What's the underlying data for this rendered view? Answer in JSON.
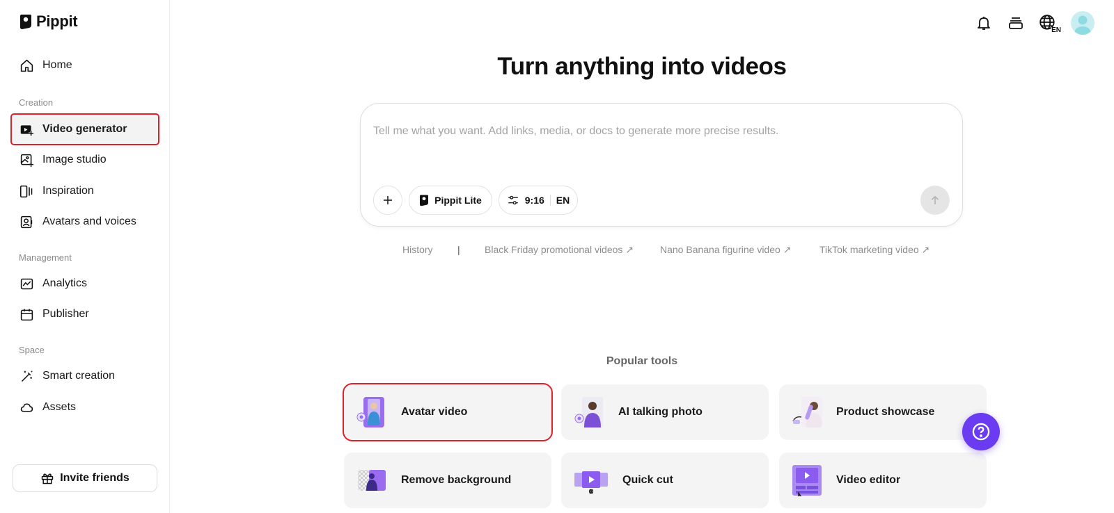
{
  "app": {
    "name": "Pippit"
  },
  "sidebar": {
    "home": "Home",
    "sections": {
      "creation": "Creation",
      "management": "Management",
      "space": "Space"
    },
    "creation_items": [
      {
        "label": "Video generator",
        "icon": "video-plus-icon",
        "active": true
      },
      {
        "label": "Image studio",
        "icon": "image-sparkle-icon"
      },
      {
        "label": "Inspiration",
        "icon": "inspiration-icon"
      },
      {
        "label": "Avatars and voices",
        "icon": "avatar-icon"
      }
    ],
    "management_items": [
      {
        "label": "Analytics",
        "icon": "chart-icon"
      },
      {
        "label": "Publisher",
        "icon": "calendar-icon"
      }
    ],
    "space_items": [
      {
        "label": "Smart creation",
        "icon": "magic-wand-icon"
      },
      {
        "label": "Assets",
        "icon": "cloud-icon"
      }
    ],
    "invite": "Invite friends"
  },
  "topbar": {
    "lang": "EN"
  },
  "main": {
    "headline": "Turn anything into videos",
    "prompt_placeholder": "Tell me what you want. Add links, media, or docs to generate more precise results.",
    "model_label": "Pippit Lite",
    "ratio": "9:16",
    "language": "EN",
    "suggestions": {
      "history": "History",
      "divider": "|",
      "items": [
        "Black Friday promotional videos ↗",
        "Nano Banana figurine video ↗",
        "TikTok marketing video ↗"
      ]
    },
    "popular_title": "Popular tools",
    "tools": [
      {
        "label": "Avatar video"
      },
      {
        "label": "AI talking photo"
      },
      {
        "label": "Product showcase"
      },
      {
        "label": "Remove background"
      },
      {
        "label": "Quick cut"
      },
      {
        "label": "Video editor"
      }
    ]
  },
  "colors": {
    "accent": "#6a3bf0",
    "highlight": "#e0202a"
  }
}
